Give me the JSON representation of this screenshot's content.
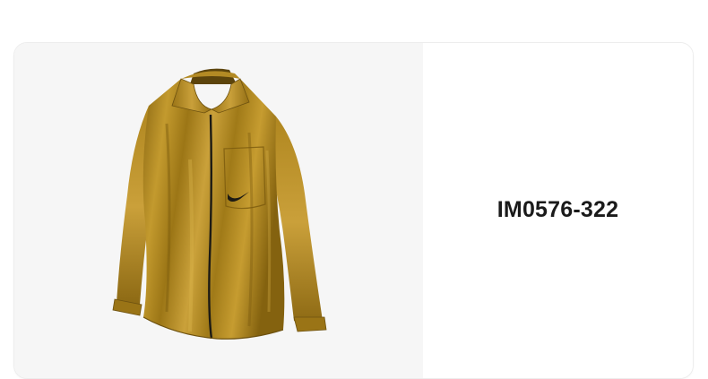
{
  "product": {
    "image_subject": "gold-satin-button-up-shirt",
    "sku": "IM0576-322"
  },
  "colors": {
    "image_background": "#f6f6f6",
    "shirt_gold": "#a8801a",
    "shirt_highlight": "#d0a53a",
    "shirt_shadow": "#6e5210",
    "placket_trim": "#1c1a14",
    "text": "#1a1a1a"
  }
}
